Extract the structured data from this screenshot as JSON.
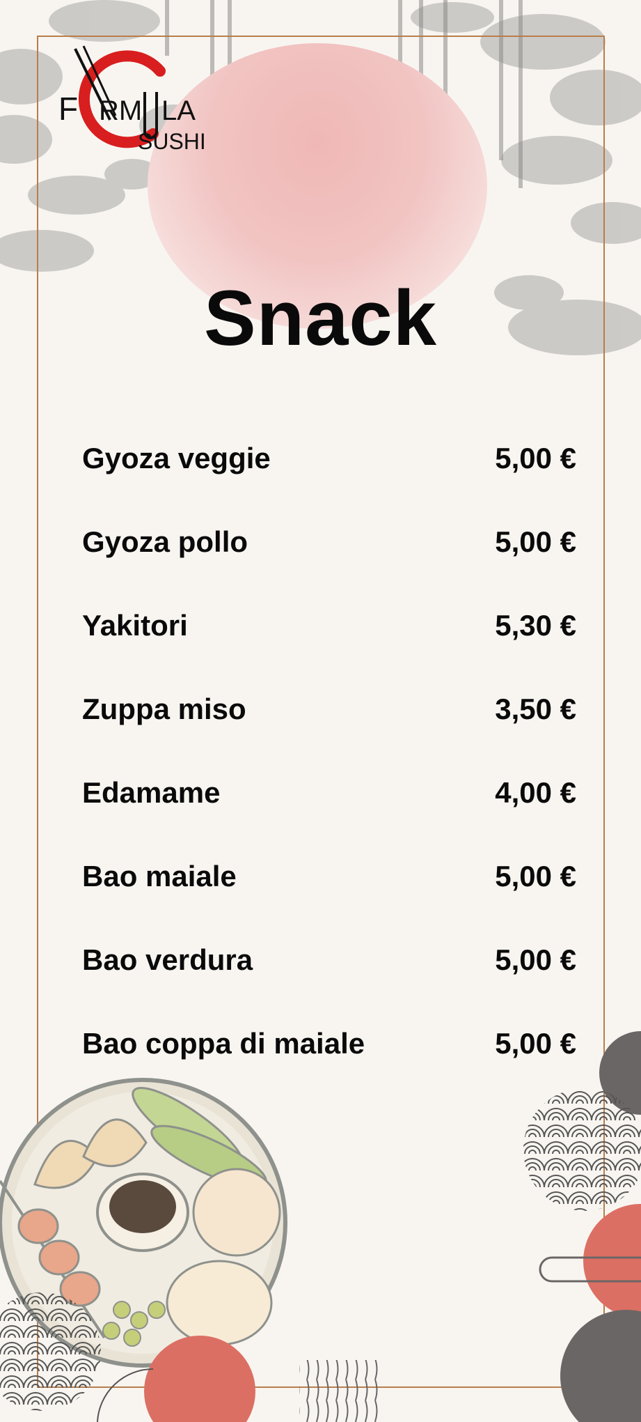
{
  "brand": {
    "logo_text_line1": "FORMULA",
    "logo_text_line2": "SUSHI",
    "accent_red": "#d81e1e",
    "frame_color": "#b87d4b"
  },
  "page": {
    "title": "Snack"
  },
  "menu": {
    "items": [
      {
        "name": "Gyoza veggie",
        "price": "5,00 €"
      },
      {
        "name": "Gyoza pollo",
        "price": "5,00 €"
      },
      {
        "name": "Yakitori",
        "price": "5,30 €"
      },
      {
        "name": "Zuppa miso",
        "price": "3,50 €"
      },
      {
        "name": "Edamame",
        "price": "4,00 €"
      },
      {
        "name": "Bao maiale",
        "price": "5,00 €"
      },
      {
        "name": "Bao verdura",
        "price": "5,00 €"
      },
      {
        "name": "Bao coppa di maiale",
        "price": "5,00 €"
      }
    ]
  },
  "decor": {
    "sun_color": "#efb8b6",
    "circle_red": "#dc6f63",
    "circle_dark": "#6b6666",
    "foliage_color": "#9a9a98",
    "illustration": "snack-platter-illustration"
  }
}
